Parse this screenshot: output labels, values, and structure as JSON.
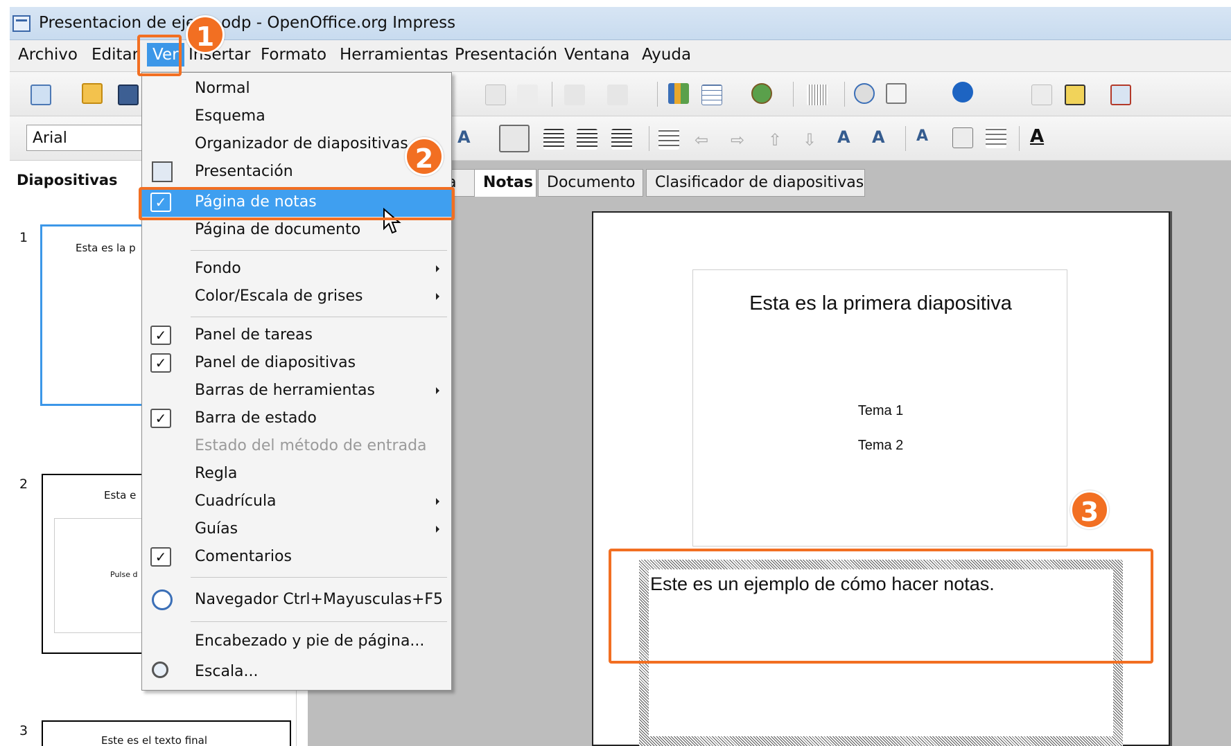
{
  "window": {
    "title": "Presentacion de ejem  .odp - OpenOffice.org Impress"
  },
  "menubar": {
    "items": [
      "Archivo",
      "Editar",
      "Ver",
      "Insertar",
      "Formato",
      "Herramientas",
      "Presentación",
      "Ventana",
      "Ayuda"
    ],
    "active": "Ver"
  },
  "toolbar": {
    "font_name": "Arial"
  },
  "slide_panel": {
    "title": "Diapositivas",
    "slides": [
      {
        "number": "1",
        "text": "Esta es la p"
      },
      {
        "number": "2",
        "text": "Esta e",
        "subtext": "Pulse d"
      },
      {
        "number": "3",
        "text": "Este es el texto final"
      }
    ]
  },
  "view_tabs": {
    "items": [
      "a",
      "Notas",
      "Documento",
      "Clasificador de diapositivas"
    ],
    "selected": "Notas"
  },
  "notes_page": {
    "slide_title": "Esta es la primera diapositiva",
    "bullets": [
      "Tema 1",
      "Tema 2"
    ],
    "notes_text": "Este es un ejemplo de cómo hacer notas."
  },
  "view_menu": {
    "items": [
      {
        "label": "Normal"
      },
      {
        "label": "Esquema"
      },
      {
        "label": "Organizador de diapositivas"
      },
      {
        "label": "Presentación",
        "icon": "presentation-icon"
      },
      {
        "label": "Página de notas",
        "checked": true,
        "highlighted": true
      },
      {
        "label": "Página de documento"
      },
      {
        "label": "Fondo",
        "submenu": true
      },
      {
        "label": "Color/Escala de grises",
        "submenu": true
      },
      {
        "label": "Panel de tareas",
        "checked": true
      },
      {
        "label": "Panel de diapositivas",
        "checked": true
      },
      {
        "label": "Barras de herramientas",
        "submenu": true
      },
      {
        "label": "Barra de estado",
        "checked": true
      },
      {
        "label": "Estado del método de entrada",
        "disabled": true
      },
      {
        "label": "Regla"
      },
      {
        "label": "Cuadrícula",
        "submenu": true
      },
      {
        "label": "Guías",
        "submenu": true
      },
      {
        "label": "Comentarios",
        "checked": true
      },
      {
        "label": "Navegador  Ctrl+Mayusculas+F5",
        "icon": "navigator-icon"
      },
      {
        "label": "Encabezado y pie de página..."
      },
      {
        "label": "Escala...",
        "icon": "zoom-icon"
      }
    ]
  },
  "annotations": {
    "step1": "1",
    "step2": "2",
    "step3": "3"
  },
  "colors": {
    "annotation": "#f26f22",
    "highlight": "#3f9ff0"
  }
}
